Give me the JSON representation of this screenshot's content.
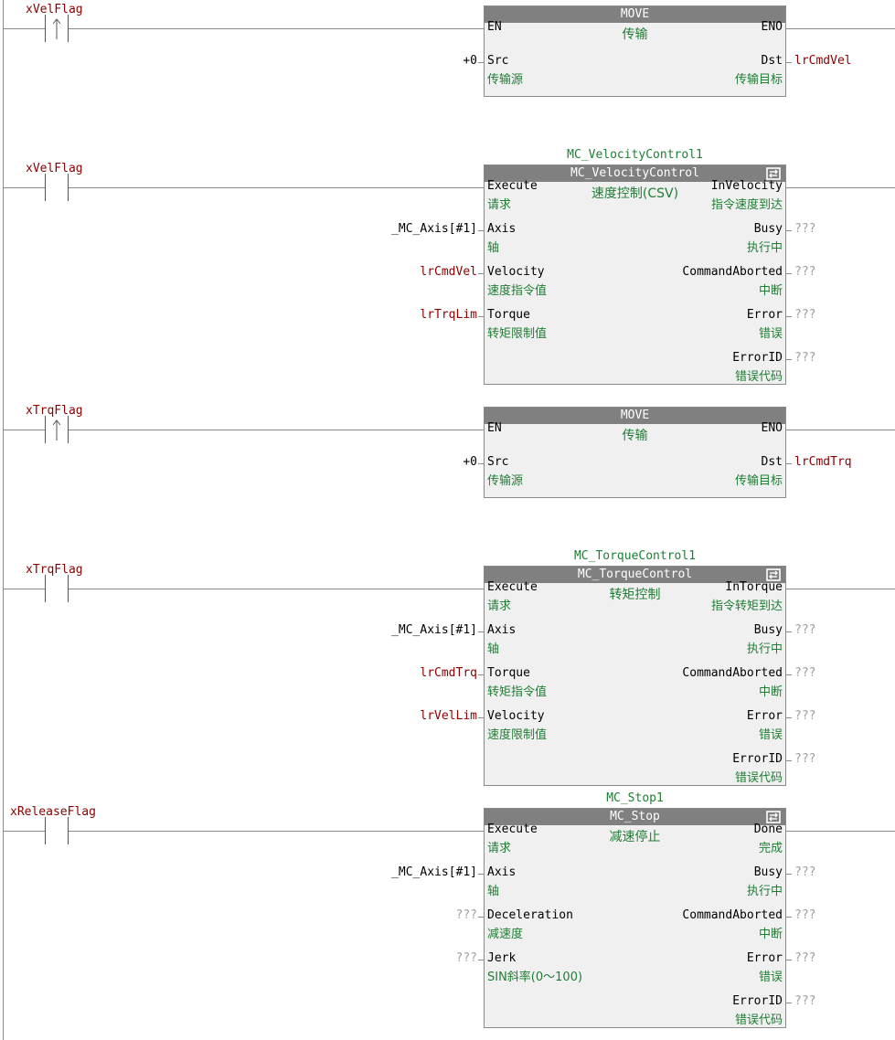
{
  "rungs": [
    {
      "contact_var": "xVelFlag",
      "contact_type": "rising-edge",
      "block": {
        "instance": "",
        "type": "MOVE",
        "desc": "传输",
        "has_reexec_icon": false,
        "in_pins": [
          {
            "name": "EN",
            "cn": "",
            "value": ""
          },
          {
            "name": "Src",
            "cn": "传输源",
            "value": "+0"
          }
        ],
        "out_pins": [
          {
            "name": "ENO",
            "cn": "",
            "value": ""
          },
          {
            "name": "Dst",
            "cn": "传输目标",
            "value": "lrCmdVel"
          }
        ]
      }
    },
    {
      "contact_var": "xVelFlag",
      "contact_type": "normally-open",
      "block": {
        "instance": "MC_VelocityControl1",
        "type": "MC_VelocityControl",
        "desc": "速度控制(CSV)",
        "has_reexec_icon": true,
        "in_pins": [
          {
            "name": "Execute",
            "cn": "请求",
            "value": ""
          },
          {
            "name": "Axis",
            "cn": "轴",
            "value": "_MC_Axis[#1]"
          },
          {
            "name": "Velocity",
            "cn": "速度指令值",
            "value": "lrCmdVel"
          },
          {
            "name": "Torque",
            "cn": "转矩限制值",
            "value": "lrTrqLim"
          }
        ],
        "out_pins": [
          {
            "name": "InVelocity",
            "cn": "指令速度到达",
            "value": ""
          },
          {
            "name": "Busy",
            "cn": "执行中",
            "value": "???"
          },
          {
            "name": "CommandAborted",
            "cn": "中断",
            "value": "???"
          },
          {
            "name": "Error",
            "cn": "错误",
            "value": "???"
          },
          {
            "name": "ErrorID",
            "cn": "错误代码",
            "value": "???"
          }
        ]
      }
    },
    {
      "contact_var": "xTrqFlag",
      "contact_type": "rising-edge",
      "block": {
        "instance": "",
        "type": "MOVE",
        "desc": "传输",
        "has_reexec_icon": false,
        "in_pins": [
          {
            "name": "EN",
            "cn": "",
            "value": ""
          },
          {
            "name": "Src",
            "cn": "传输源",
            "value": "+0"
          }
        ],
        "out_pins": [
          {
            "name": "ENO",
            "cn": "",
            "value": ""
          },
          {
            "name": "Dst",
            "cn": "传输目标",
            "value": "lrCmdTrq"
          }
        ]
      }
    },
    {
      "contact_var": "xTrqFlag",
      "contact_type": "normally-open",
      "block": {
        "instance": "MC_TorqueControl1",
        "type": "MC_TorqueControl",
        "desc": "转矩控制",
        "has_reexec_icon": true,
        "in_pins": [
          {
            "name": "Execute",
            "cn": "请求",
            "value": ""
          },
          {
            "name": "Axis",
            "cn": "轴",
            "value": "_MC_Axis[#1]"
          },
          {
            "name": "Torque",
            "cn": "转矩指令值",
            "value": "lrCmdTrq"
          },
          {
            "name": "Velocity",
            "cn": "速度限制值",
            "value": "lrVelLim"
          }
        ],
        "out_pins": [
          {
            "name": "InTorque",
            "cn": "指令转矩到达",
            "value": ""
          },
          {
            "name": "Busy",
            "cn": "执行中",
            "value": "???"
          },
          {
            "name": "CommandAborted",
            "cn": "中断",
            "value": "???"
          },
          {
            "name": "Error",
            "cn": "错误",
            "value": "???"
          },
          {
            "name": "ErrorID",
            "cn": "错误代码",
            "value": "???"
          }
        ]
      }
    },
    {
      "contact_var": "xReleaseFlag",
      "contact_type": "normally-open",
      "block": {
        "instance": "MC_Stop1",
        "type": "MC_Stop",
        "desc": "减速停止",
        "has_reexec_icon": true,
        "in_pins": [
          {
            "name": "Execute",
            "cn": "请求",
            "value": ""
          },
          {
            "name": "Axis",
            "cn": "轴",
            "value": "_MC_Axis[#1]"
          },
          {
            "name": "Deceleration",
            "cn": "减速度",
            "value": "???"
          },
          {
            "name": "Jerk",
            "cn": "SIN斜率(0～100)",
            "value": "???"
          }
        ],
        "out_pins": [
          {
            "name": "Done",
            "cn": "完成",
            "value": ""
          },
          {
            "name": "Busy",
            "cn": "执行中",
            "value": "???"
          },
          {
            "name": "CommandAborted",
            "cn": "中断",
            "value": "???"
          },
          {
            "name": "Error",
            "cn": "错误",
            "value": "???"
          },
          {
            "name": "ErrorID",
            "cn": "错误代码",
            "value": "???"
          }
        ]
      }
    }
  ],
  "colors": {
    "variable": "#8b0000",
    "instance": "#1e7e34",
    "unassigned": "#a0a0a0",
    "block_header": "#808080",
    "block_body": "#f0f0f0"
  }
}
